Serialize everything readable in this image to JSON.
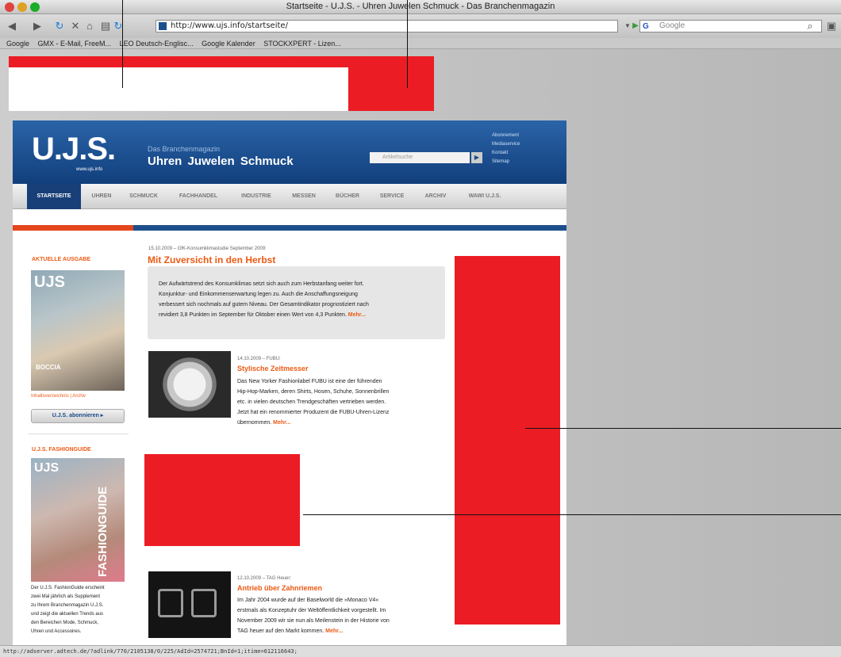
{
  "window": {
    "title": "Startseite - U.J.S. - Uhren Juwelen Schmuck - Das Branchenmagazin"
  },
  "toolbar": {
    "url": "http://www.ujs.info/startseite/",
    "search_placeholder": "Google",
    "search_engine": "G"
  },
  "bookmarks": [
    "Google",
    "GMX - E-Mail, FreeM...",
    "LEO Deutsch-Englisc...",
    "Google Kalender",
    "STOCKXPERT - Lizen..."
  ],
  "site": {
    "logo": "U.J.S.",
    "logo_url": "www.ujs.info",
    "kicker": "Das Branchenmagazin",
    "tagline": "Uhren Juwelen Schmuck",
    "search_placeholder": "Artikelsuche",
    "search_go": "▶",
    "service_links": [
      "Abonnement",
      "Mediaservice",
      "Kontakt",
      "Sitemap"
    ],
    "nav": [
      "STARTSEITE",
      "UHREN",
      "SCHMUCK",
      "FACHHANDEL",
      "INDUSTRIE",
      "MESSEN",
      "BÜCHER",
      "SERVICE",
      "ARCHIV",
      "WAWI U.J.S."
    ]
  },
  "sidebar": {
    "current_issue_title": "AKTUELLE AUSGABE",
    "cover_masthead": "UJS",
    "cover_brand": "BOCCIA",
    "issue_links": "Inhaltsverzeichnis | Archiv",
    "subscribe_button": "U.J.S. abonnieren ▸",
    "fashionguide_title": "U.J.S. FASHIONGUIDE",
    "fashionguide_cover_masthead": "UJS",
    "fashionguide_cover_word": "FASHIONGUIDE",
    "fashionguide_lines": [
      "Der U.J.S. FashionGuide erscheint",
      "zwei Mal jährlich als Supplement",
      "zu Ihrem Branchenmagazin U.J.S.",
      "und zeigt die aktuellen Trends aus",
      "den Bereichen Mode, Schmuck,",
      "Uhren und Accessoires."
    ]
  },
  "articles": [
    {
      "meta": "15.10.2009 – GfK-Konsumklimastudie September 2009:",
      "headline": "Mit Zuversicht in den Herbst",
      "lines": [
        "Der Aufwärtstrend des Konsumklimas setzt sich auch zum Herbstanfang weiter fort.",
        "Konjunktur- und Einkommenserwartung legen zu. Auch die Anschaffungsneigung",
        "verbessert sich nochmals auf gutem Niveau. Der Gesamtindikator prognostiziert nach",
        "revidiert 3,8 Punkten im September für Oktober einen Wert von 4,3 Punkten."
      ],
      "more": "Mehr..."
    },
    {
      "meta": "14.10.2009 – FUBU:",
      "headline": "Stylische Zeitmesser",
      "lines": [
        "Das New Yorker Fashionlabel FUBU ist eine der führenden",
        "Hip-Hop-Marken, deren Shirts, Hosen, Schuhe, Sonnenbrillen",
        "etc. in vielen deutschen Trendgeschäften vertrieben werden.",
        "Jetzt hat ein renommierter Produzent die FUBU-Uhren-Lizenz",
        "übernommen."
      ],
      "more": "Mehr..."
    },
    {
      "meta": "12.10.2009 – TAG Heuer:",
      "headline": "Antrieb über Zahnriemen",
      "lines": [
        "Im Jahr 2004 wurde auf der Baselworld die »Monaco V4«",
        "erstmals als Konzeptuhr der Weltöffentlichkeit vorgestellt. Im",
        "November 2009 wir sie nun als Meilenstein in der Historie von",
        "TAG heuer auf den Markt kommen."
      ],
      "more": "Mehr..."
    }
  ],
  "status": {
    "url": "http://adserver.adtech.de/?adlink/770/2105138/0/225/AdId=2574721;BnId=1;itime=612116643;"
  },
  "colors": {
    "annotation_red": "#ec1c24",
    "header_blue": "#1d4f8c",
    "accent_orange": "#ec5a14"
  }
}
